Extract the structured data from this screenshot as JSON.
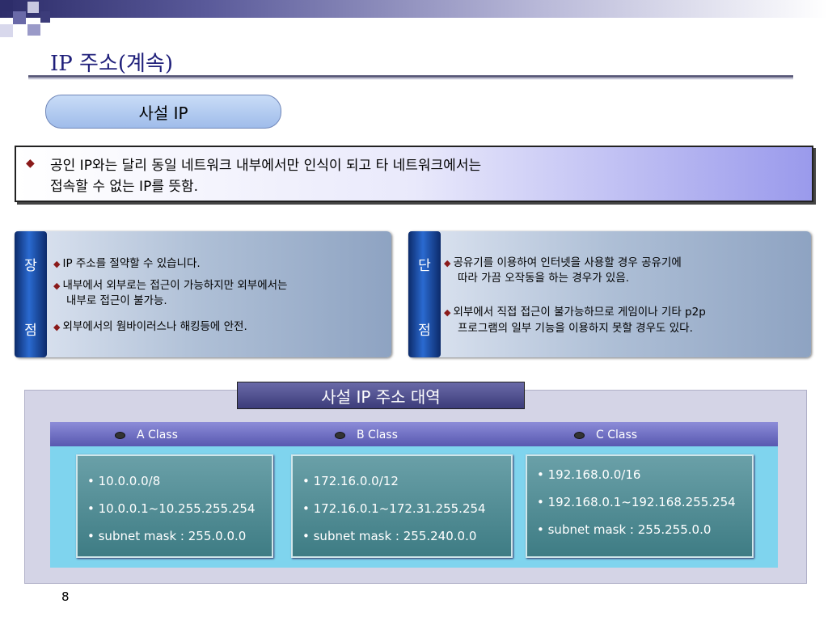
{
  "slide": {
    "title": "IP 주소(계속)",
    "heading": "사설 IP",
    "definition": {
      "bullet": "◆",
      "line1": "공인 IP와는 달리 동일 네트워크 내부에서만 인식이 되고 타 네트워크에서는",
      "line2": "접속할 수 없는 IP를 뜻함."
    },
    "advantages": {
      "tab_top": "장",
      "tab_bottom": "점",
      "items": [
        "IP 주소를 절약할 수 있습니다.",
        "내부에서 외부로는 접근이 가능하지만 외부에서는",
        "내부로 접근이 불가능.",
        "외부에서의 웜바이러스나 해킹등에 안전."
      ]
    },
    "disadvantages": {
      "tab_top": "단",
      "tab_bottom": "점",
      "items": [
        "공유기를 이용하여 인터넷을 사용할 경우 공유기에",
        "따라 가끔 오작동을 하는 경우가 있음.",
        "외부에서 직접 접근이 불가능하므로 게임이나 기타 p2p",
        "프로그램의 일부 기능을 이용하지 못할 경우도 있다."
      ]
    },
    "ranges": {
      "title": "사설 IP 주소 대역",
      "classes": [
        {
          "label": "A Class",
          "lines": [
            "• 10.0.0.0/8",
            "• 10.0.0.1~10.255.255.254",
            "• subnet mask : 255.0.0.0"
          ]
        },
        {
          "label": "B Class",
          "lines": [
            "• 172.16.0.0/12",
            "• 172.16.0.1~172.31.255.254",
            "•  subnet mask : 255.240.0.0"
          ]
        },
        {
          "label": "C Class",
          "lines": [
            "• 192.168.0.0/16",
            "• 192.168.0.1~192.168.255.254",
            "• subnet mask : 255.255.0.0"
          ]
        }
      ]
    },
    "page_number": "8"
  }
}
